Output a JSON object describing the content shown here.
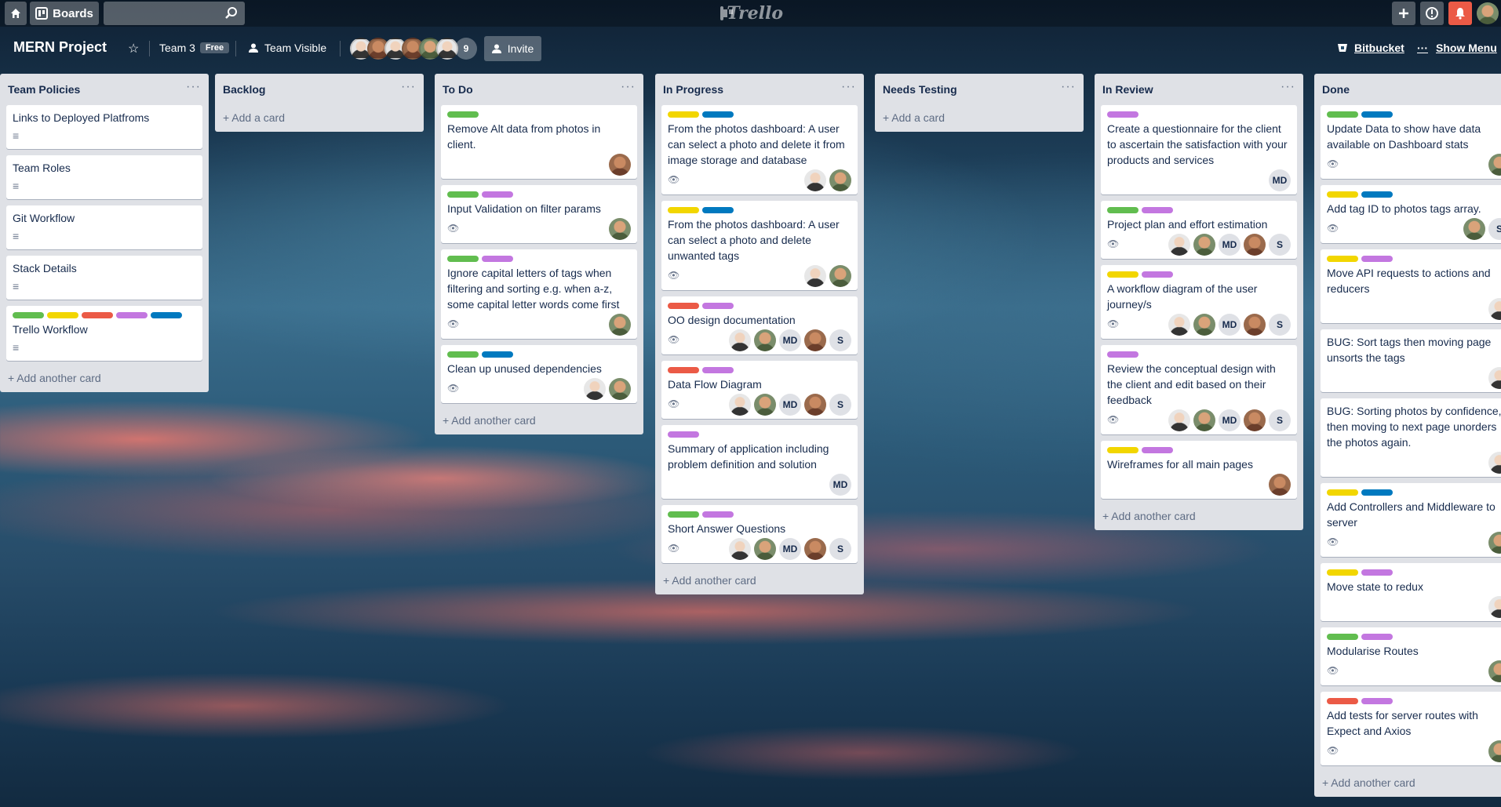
{
  "topnav": {
    "home_icon": "home-icon",
    "boards_label": "Boards",
    "search_icon": "search-icon",
    "logo_text": "Trello",
    "plus_icon": "plus-icon",
    "info_icon": "info-icon",
    "bell_icon": "bell-icon"
  },
  "header": {
    "board_title": "MERN Project",
    "team_name": "Team 3",
    "team_badge": "Free",
    "visibility": "Team Visible",
    "member_count": "9",
    "invite_label": "Invite",
    "bitbucket_label": "Bitbucket",
    "menu_label": "Show Menu"
  },
  "colors": {
    "green": "#61bd4f",
    "yellow": "#f2d600",
    "red": "#eb5a46",
    "purple": "#c377e0",
    "blue": "#0079bf"
  },
  "lists": [
    {
      "title": "Team Policies",
      "footer": "Add another card",
      "cards": [
        {
          "text": "Links to Deployed Platfroms",
          "labels": [],
          "icon": "description",
          "members": []
        },
        {
          "text": "Team Roles",
          "labels": [],
          "icon": "description",
          "members": []
        },
        {
          "text": "Git Workflow",
          "labels": [],
          "icon": "description",
          "members": []
        },
        {
          "text": "Stack Details",
          "labels": [],
          "icon": "description",
          "members": []
        },
        {
          "text": "Trello Workflow",
          "labels": [
            "green",
            "yellow",
            "red",
            "purple",
            "blue"
          ],
          "icon": "description",
          "members": []
        }
      ]
    },
    {
      "title": "Backlog",
      "footer": "Add a card",
      "cards": []
    },
    {
      "title": "To Do",
      "footer": "Add another card",
      "cards": [
        {
          "text": "Remove Alt data from photos in client.",
          "labels": [
            "green"
          ],
          "icon": "",
          "members": [
            "p3"
          ]
        },
        {
          "text": "Input Validation on filter params",
          "labels": [
            "green",
            "purple"
          ],
          "icon": "watch",
          "members": [
            "p1"
          ]
        },
        {
          "text": "Ignore capital letters of tags when filtering and sorting e.g. when a-z, some capital letter words come first",
          "labels": [
            "green",
            "purple"
          ],
          "icon": "watch",
          "members": [
            "p1"
          ]
        },
        {
          "text": "Clean up unused dependencies",
          "labels": [
            "green",
            "blue"
          ],
          "icon": "watch",
          "members": [
            "p2",
            "p1"
          ]
        }
      ]
    },
    {
      "title": "In Progress",
      "footer": "Add another card",
      "cards": [
        {
          "text": "From the photos dashboard: A user can select a photo and delete it from image storage and database",
          "labels": [
            "yellow",
            "blue"
          ],
          "icon": "watch",
          "members": [
            "p2",
            "p1"
          ]
        },
        {
          "text": "From the photos dashboard: A user can select a photo and delete unwanted tags",
          "labels": [
            "yellow",
            "blue"
          ],
          "icon": "watch",
          "members": [
            "p2",
            "p1"
          ]
        },
        {
          "text": "OO design documentation",
          "labels": [
            "red",
            "purple"
          ],
          "icon": "watch",
          "members": [
            "p2",
            "p1",
            "MD",
            "p3",
            "S"
          ]
        },
        {
          "text": "Data Flow Diagram",
          "labels": [
            "red",
            "purple"
          ],
          "icon": "watch",
          "members": [
            "p2",
            "p1",
            "MD",
            "p3",
            "S"
          ]
        },
        {
          "text": "Summary of application including problem definition and solution",
          "labels": [
            "purple"
          ],
          "icon": "",
          "members": [
            "MD"
          ]
        },
        {
          "text": "Short Answer Questions",
          "labels": [
            "green",
            "purple"
          ],
          "icon": "watch",
          "members": [
            "p2",
            "p1",
            "MD",
            "p3",
            "S"
          ]
        }
      ]
    },
    {
      "title": "Needs Testing",
      "footer": "Add a card",
      "cards": []
    },
    {
      "title": "In Review",
      "footer": "Add another card",
      "cards": [
        {
          "text": "Create a questionnaire for the client to ascertain the satisfaction with your products and services",
          "labels": [
            "purple"
          ],
          "icon": "",
          "members": [
            "MD"
          ]
        },
        {
          "text": "Project plan and effort estimation",
          "labels": [
            "green",
            "purple"
          ],
          "icon": "watch",
          "members": [
            "p2",
            "p1",
            "MD",
            "p3",
            "S"
          ]
        },
        {
          "text": "A workflow diagram of the user journey/s",
          "labels": [
            "yellow",
            "purple"
          ],
          "icon": "watch",
          "members": [
            "p2",
            "p1",
            "MD",
            "p3",
            "S"
          ]
        },
        {
          "text": "Review the conceptual design with the client and edit based on their feedback",
          "labels": [
            "purple"
          ],
          "icon": "watch",
          "members": [
            "p2",
            "p1",
            "MD",
            "p3",
            "S"
          ]
        },
        {
          "text": "Wireframes for all main pages",
          "labels": [
            "yellow",
            "purple"
          ],
          "icon": "",
          "members": [
            "p3"
          ]
        }
      ]
    },
    {
      "title": "Done",
      "footer": "Add another card",
      "cards": [
        {
          "text": "Update Data to show have data available on Dashboard stats",
          "labels": [
            "green",
            "blue"
          ],
          "icon": "watch",
          "members": [
            "p1"
          ]
        },
        {
          "text": "Add tag ID to photos tags array.",
          "labels": [
            "yellow",
            "blue"
          ],
          "icon": "watch",
          "members": [
            "p1",
            "S"
          ]
        },
        {
          "text": "Move API requests to actions and reducers",
          "labels": [
            "yellow",
            "purple"
          ],
          "icon": "",
          "members": [
            "p2"
          ]
        },
        {
          "text": "BUG: Sort tags then moving page unsorts the tags",
          "labels": [],
          "icon": "",
          "members": [
            "p2"
          ]
        },
        {
          "text": "BUG: Sorting photos by confidence, then moving to next page unorders the photos again.",
          "labels": [],
          "icon": "",
          "members": [
            "p2"
          ]
        },
        {
          "text": "Add Controllers and Middleware to server",
          "labels": [
            "yellow",
            "blue"
          ],
          "icon": "watch",
          "members": [
            "p1"
          ]
        },
        {
          "text": "Move state to redux",
          "labels": [
            "yellow",
            "purple"
          ],
          "icon": "",
          "members": [
            "p2"
          ]
        },
        {
          "text": "Modularise Routes",
          "labels": [
            "green",
            "purple"
          ],
          "icon": "watch",
          "members": [
            "p1"
          ]
        },
        {
          "text": "Add tests for server routes with Expect and Axios",
          "labels": [
            "red",
            "purple"
          ],
          "icon": "watch",
          "members": [
            "p1"
          ]
        }
      ]
    }
  ]
}
